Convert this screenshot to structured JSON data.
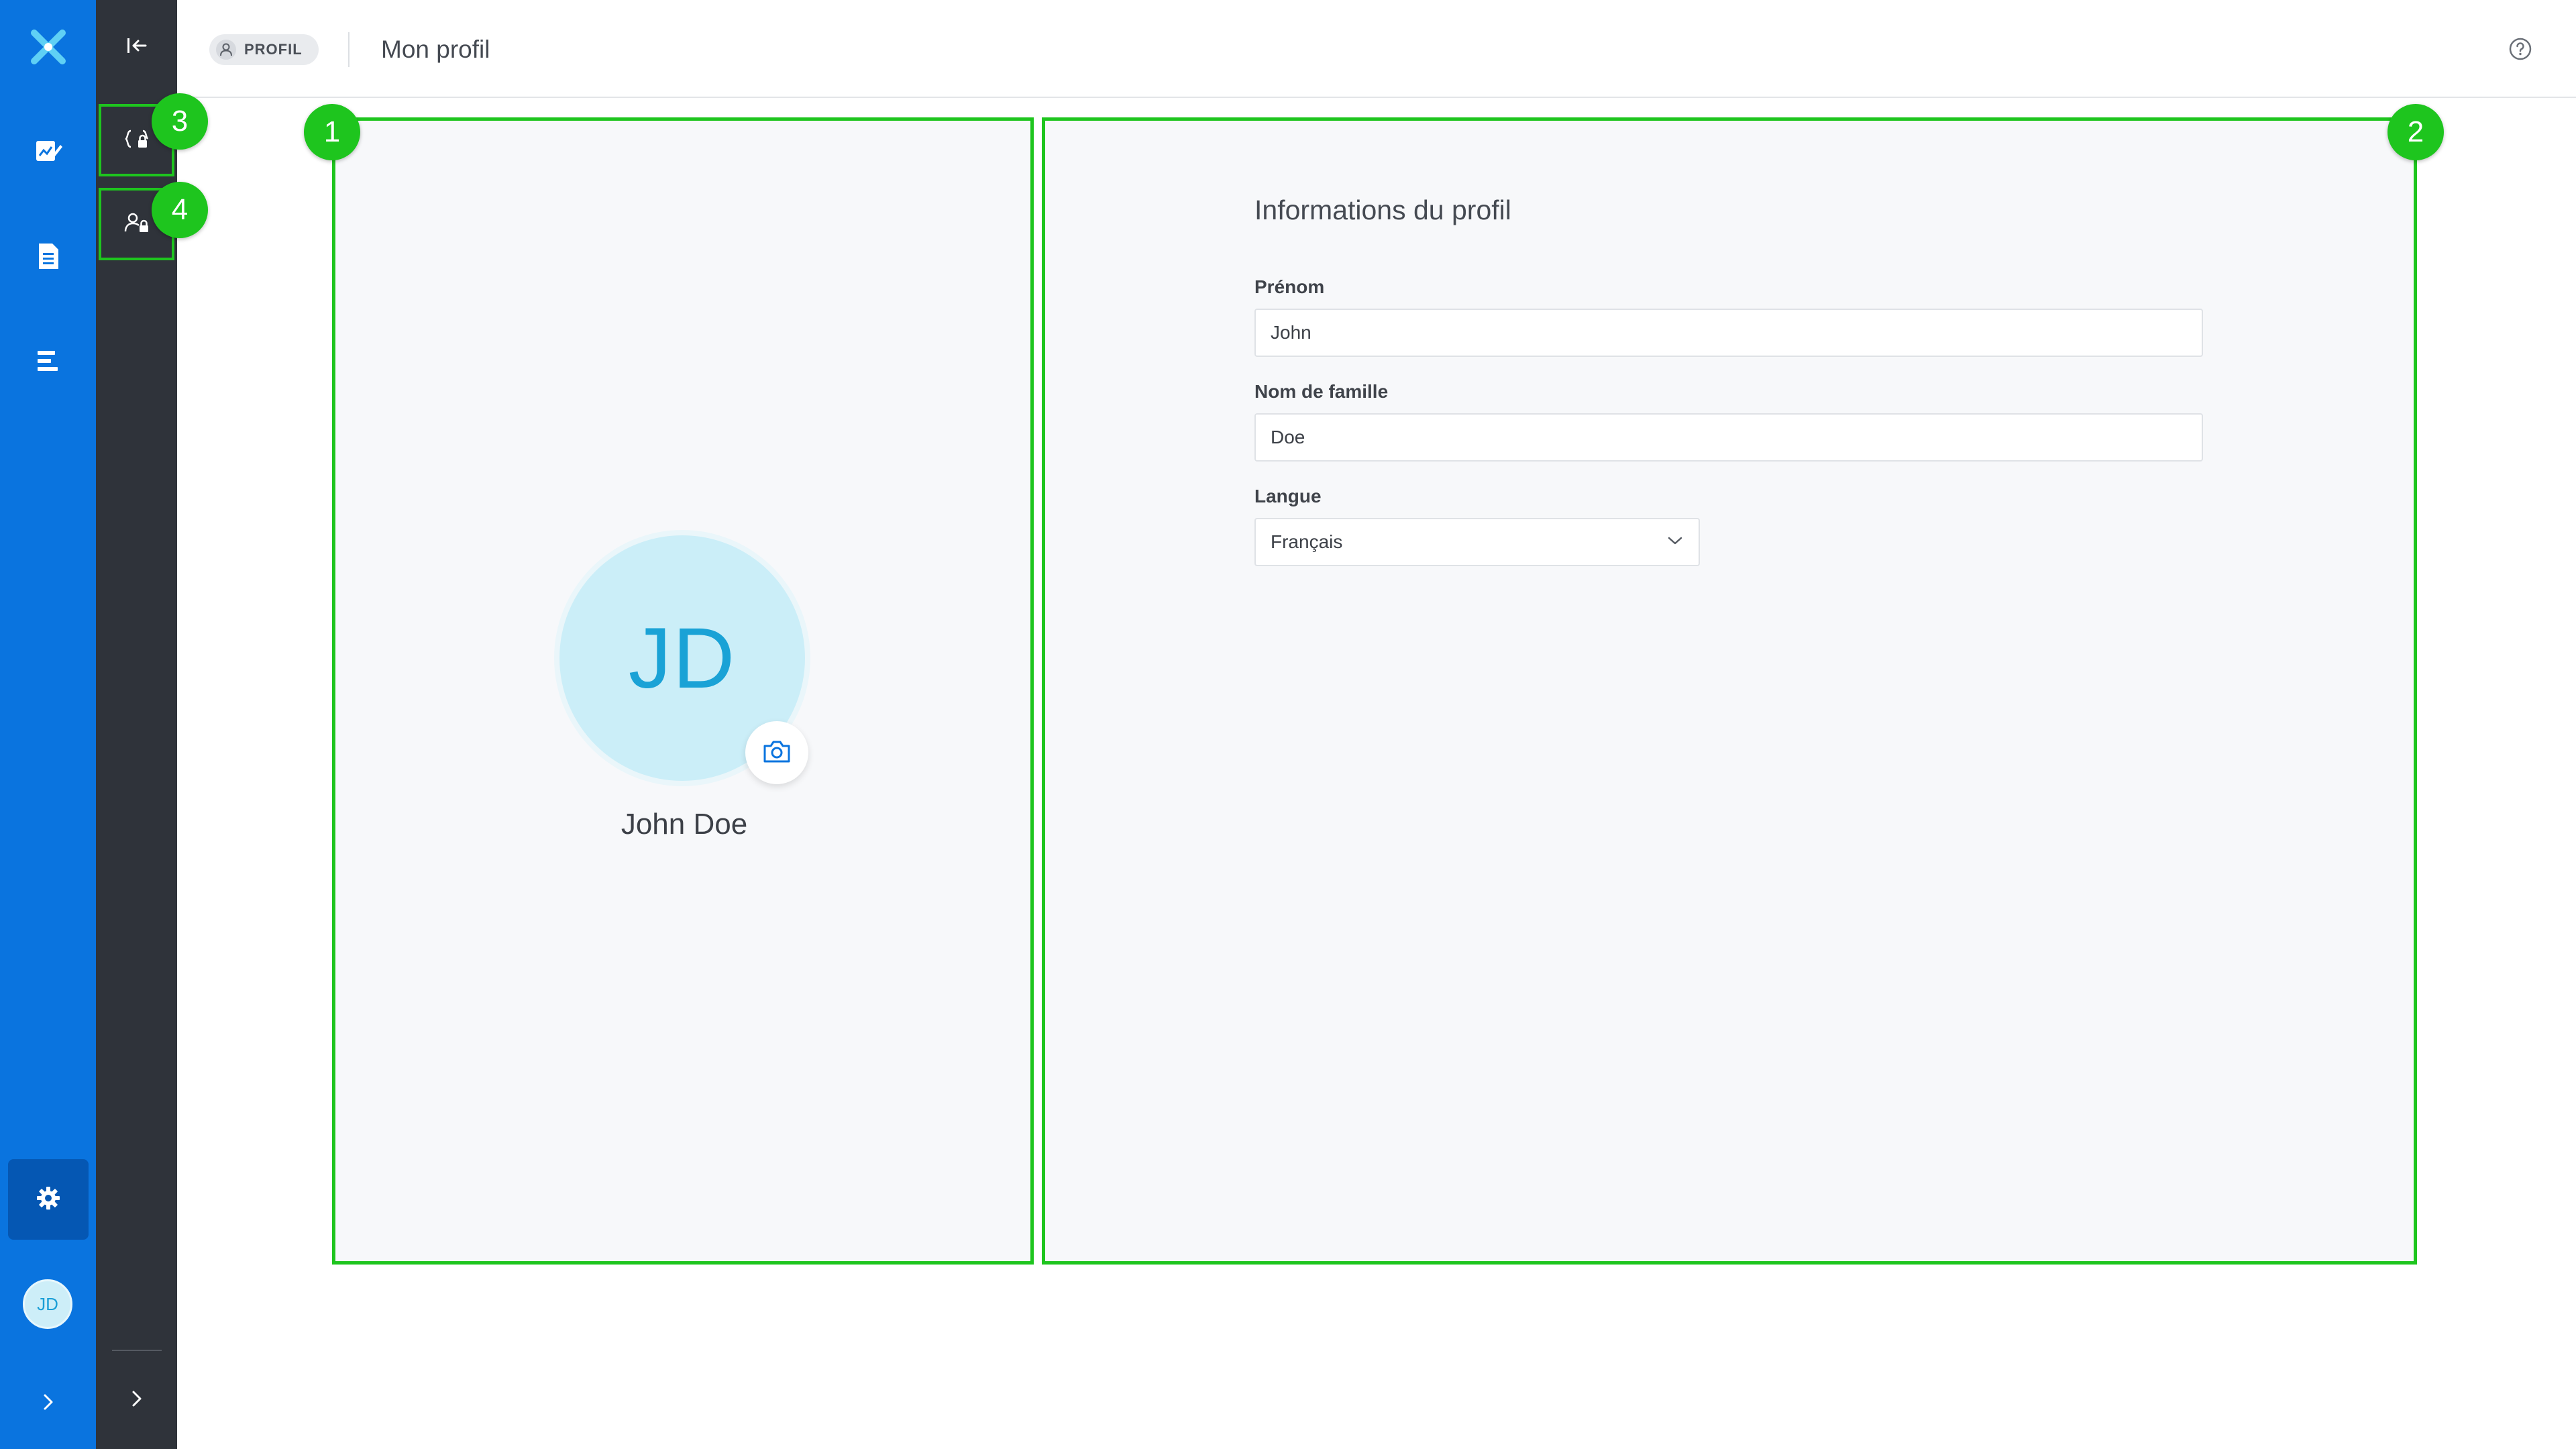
{
  "app": {
    "logo": "x-logo-icon"
  },
  "rail": {
    "items": [
      {
        "icon": "edit-chart-icon",
        "label": ""
      },
      {
        "icon": "document-icon",
        "label": ""
      },
      {
        "icon": "list-icon",
        "label": ""
      }
    ],
    "settings_icon": "gear-icon",
    "avatar_initials": "JD",
    "expand_icon": "chevron-right-icon"
  },
  "subrail": {
    "collapse_icon": "collapse-left-icon",
    "items": [
      {
        "icon": "code-lock-icon"
      },
      {
        "icon": "user-lock-icon"
      }
    ],
    "expand_icon": "chevron-right-icon"
  },
  "header": {
    "breadcrumb_label": "PROFIL",
    "breadcrumb_icon": "user-icon",
    "title": "Mon profil",
    "help_icon": "help-circle-icon"
  },
  "profile": {
    "initials": "JD",
    "name": "John Doe",
    "camera_icon": "camera-icon"
  },
  "form": {
    "title": "Informations du profil",
    "first_name_label": "Prénom",
    "first_name_value": "John",
    "last_name_label": "Nom de famille",
    "last_name_value": "Doe",
    "language_label": "Langue",
    "language_value": "Français"
  },
  "callouts": [
    "1",
    "2",
    "3",
    "4"
  ],
  "colors": {
    "primary_rail": "#0a74df",
    "dark_rail": "#2f333a",
    "highlight": "#1ec51e",
    "avatar_bg": "#cbeef8",
    "avatar_text": "#1aa2d6"
  }
}
